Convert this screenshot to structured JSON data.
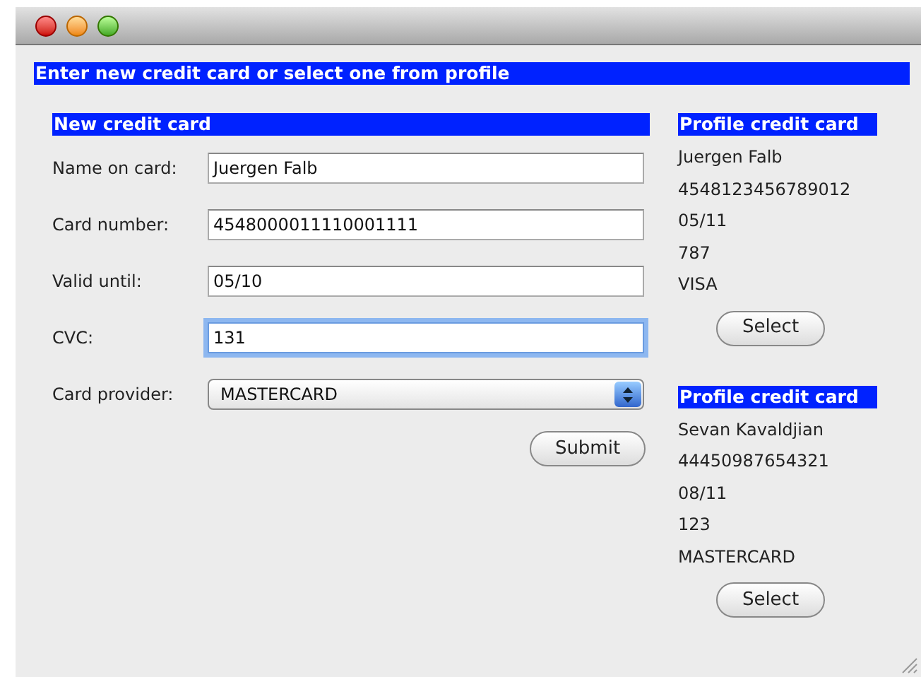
{
  "window": {
    "title_banner": "Enter new credit card or select one from profile"
  },
  "new_card": {
    "heading": "New credit card",
    "fields": [
      {
        "kind": "text",
        "label": "Name on card:",
        "value": "Juergen Falb",
        "focused": false
      },
      {
        "kind": "text",
        "label": "Card number:",
        "value": "4548000011110001111",
        "focused": false
      },
      {
        "kind": "text",
        "label": "Valid until:",
        "value": "05/10",
        "focused": false
      },
      {
        "kind": "text",
        "label": "CVC:",
        "value": "131",
        "focused": true
      },
      {
        "kind": "select",
        "label": "Card provider:",
        "value": "MASTERCARD",
        "focused": false
      }
    ],
    "submit": "Submit"
  },
  "profile_cards": [
    {
      "heading": "Profile credit card",
      "lines": [
        "Juergen Falb",
        "4548123456789012",
        "05/11",
        "787",
        "VISA"
      ],
      "button": "Select"
    },
    {
      "heading": "Profile credit card",
      "lines": [
        "Sevan Kavaldjian",
        "44450987654321",
        "08/11",
        "123",
        "MASTERCARD"
      ],
      "button": "Select"
    }
  ]
}
